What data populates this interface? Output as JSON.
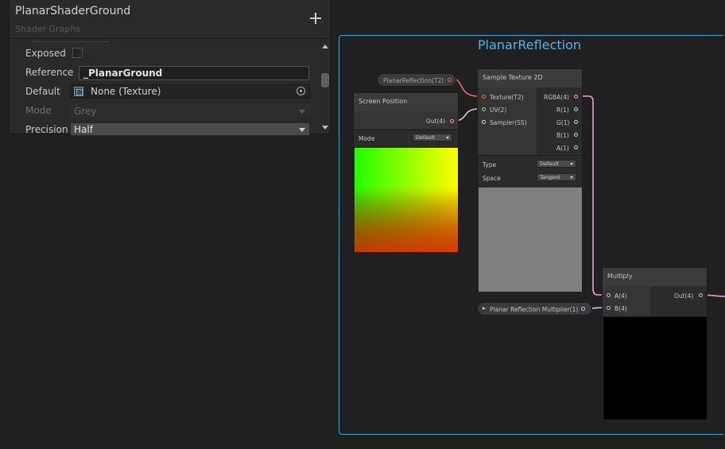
{
  "blackboard": {
    "title": "PlanarShaderGround",
    "subtitle": "Shader Graphs",
    "properties": {
      "exposed_label": "Exposed",
      "exposed_checked": false,
      "reference_label": "Reference",
      "reference_value": "_PlanarGround",
      "default_label": "Default",
      "default_value": "None (Texture)",
      "mode_label": "Mode",
      "mode_value": "Grey",
      "precision_label": "Precision",
      "precision_value": "Half"
    }
  },
  "group": {
    "title": "PlanarReflection"
  },
  "nodes": {
    "property_reflection": {
      "label": "PlanarReflection(T2)"
    },
    "screen_position": {
      "title": "Screen Position",
      "output": "Out(4)",
      "mode_label": "Mode",
      "mode_value": "Default"
    },
    "sample_texture": {
      "title": "Sample Texture 2D",
      "inputs": [
        "Texture(T2)",
        "UV(2)",
        "Sampler(SS)"
      ],
      "outputs": [
        "RGBA(4)",
        "R(1)",
        "G(1)",
        "B(1)",
        "A(1)"
      ],
      "type_label": "Type",
      "type_value": "Default",
      "space_label": "Space",
      "space_value": "Tangent"
    },
    "multiplier_property": {
      "label": "Planar Reflection Multiplier(1)"
    },
    "multiply": {
      "title": "Multiply",
      "inputs": [
        "A(4)",
        "B(4)"
      ],
      "output": "Out(4)"
    }
  },
  "colors": {
    "group_border": "#3aa0d6",
    "group_title": "#4eb2ee",
    "wire_vector4": "#f39acb",
    "wire_texture": "#f06a6a",
    "wire_vector2": "#cfcfcf"
  }
}
